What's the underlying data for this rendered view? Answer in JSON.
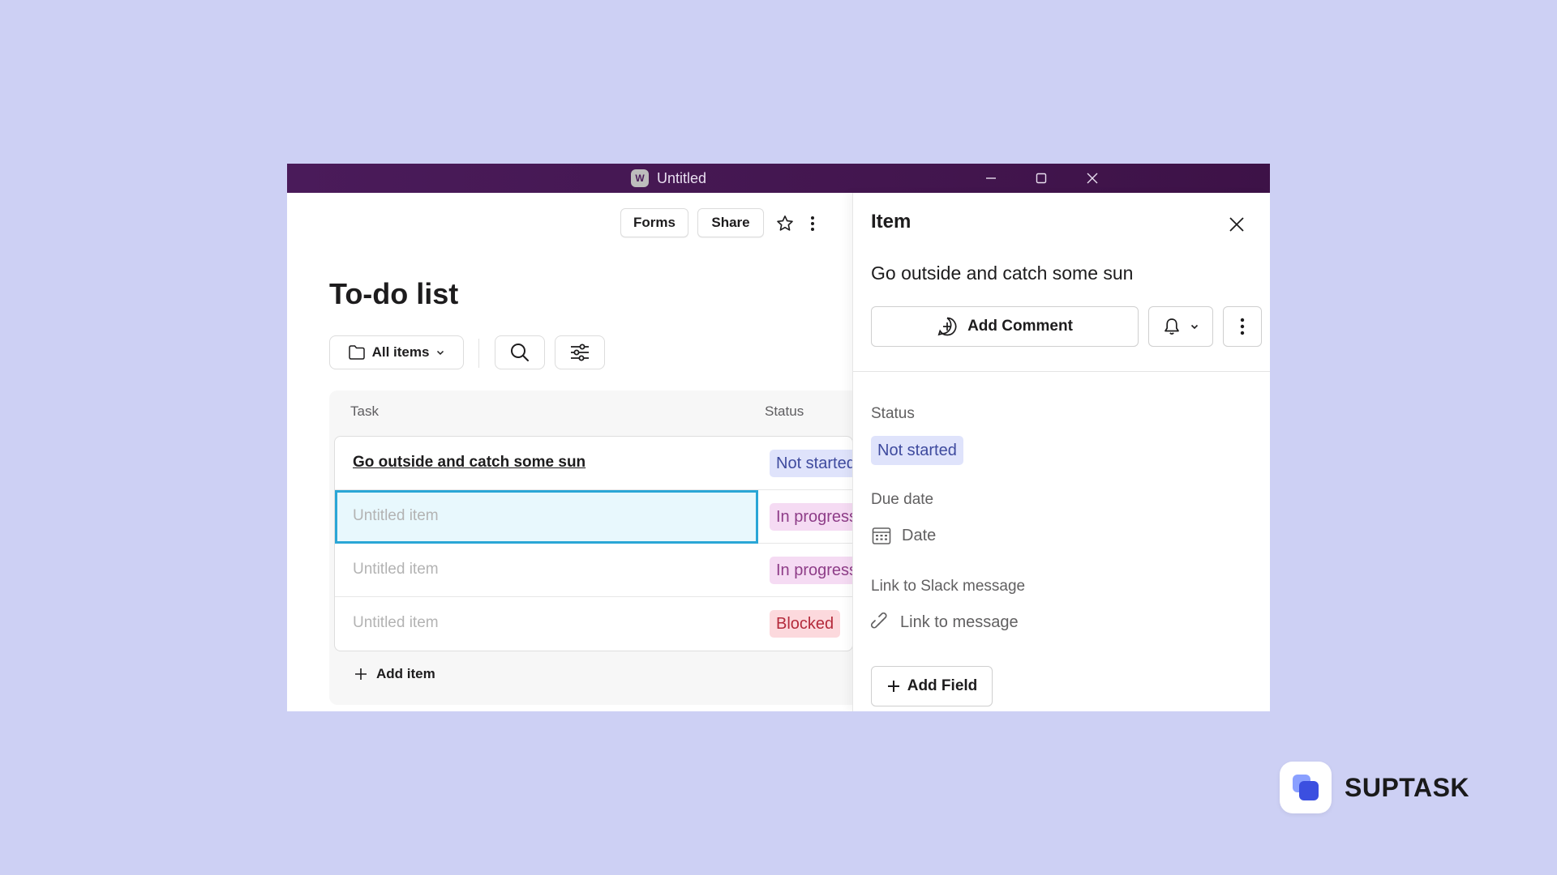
{
  "window": {
    "title": "Untitled",
    "app_badge": "W",
    "titlebar_color": "#47185a",
    "controls": [
      "minimize-icon",
      "maximize-icon",
      "close-icon"
    ]
  },
  "list": {
    "forms_label": "Forms",
    "share_label": "Share",
    "title": "To-do list",
    "filter_label": "All items",
    "columns": {
      "task": "Task",
      "status": "Status"
    },
    "rows": [
      {
        "task": "Go outside and catch some sun",
        "status": "Not started"
      },
      {
        "task": "Untitled item",
        "status": "In progress"
      },
      {
        "task": "Untitled item",
        "status": "In progress"
      },
      {
        "task": "Untitled item",
        "status": "Blocked"
      }
    ],
    "add_item_label": "Add item"
  },
  "panel": {
    "title": "Item",
    "item_name": "Go outside and catch some sun",
    "add_comment_label": "Add Comment",
    "status_label": "Status",
    "status_value": "Not started",
    "due_date_label": "Due date",
    "due_date_placeholder": "Date",
    "slack_label": "Link to Slack message",
    "slack_placeholder": "Link to message",
    "add_field_label": "Add Field"
  },
  "brand": {
    "name": "SUPTASK",
    "accent": "#3b4fe0"
  },
  "colors": {
    "background": "#cdd0f4",
    "not_started": "#dfe3fb",
    "in_progress": "#f5dbf3",
    "blocked": "#fcd9dd",
    "selection": "#2aa6d6"
  }
}
